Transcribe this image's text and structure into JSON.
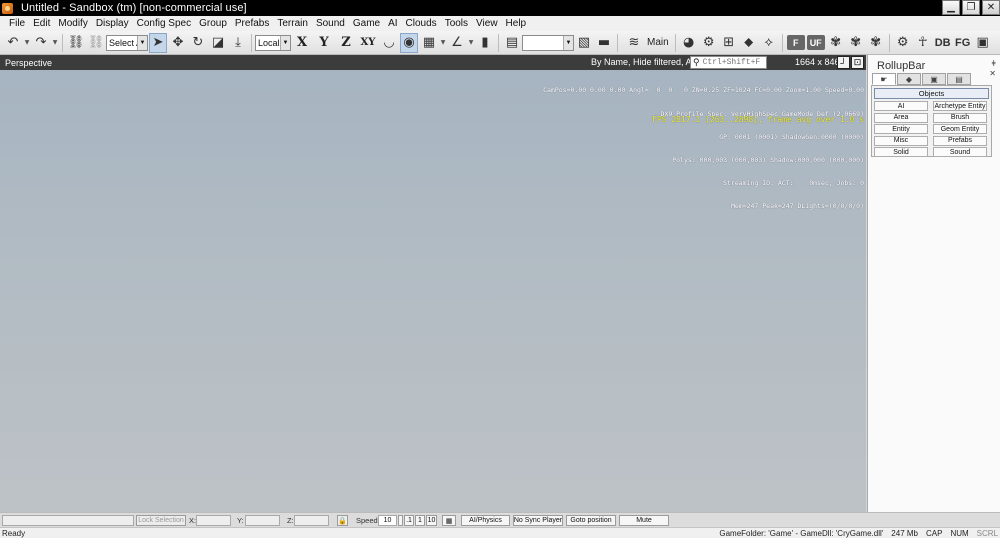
{
  "window": {
    "title": "Untitled - Sandbox (tm) [non-commercial use]",
    "controls": {
      "minimize": "▁",
      "maximize": "❐",
      "close": "✕"
    }
  },
  "menu": [
    "File",
    "Edit",
    "Modify",
    "Display",
    "Config Spec",
    "Group",
    "Prefabs",
    "Terrain",
    "Sound",
    "Game",
    "AI",
    "Clouds",
    "Tools",
    "View",
    "Help"
  ],
  "toolbar": {
    "undo_icon": "↶",
    "redo_icon": "↷",
    "dropdown_glyph": "▼",
    "link_icon": "⛓",
    "unlink_icon": "⛓",
    "selection_filter": "Select All",
    "select_icon": "➤",
    "move_icon": "✥",
    "rotate_icon": "↻",
    "scale_icon": "◪",
    "drop_icon": "⤓",
    "ref_coord": "Local",
    "axis_x": "X",
    "axis_y": "Y",
    "axis_z": "Z",
    "axis_xy": "XY",
    "terrain_snap_icon": "◡",
    "object_snap_icon": "◉",
    "grid_icon": "▦",
    "angle_icon": "∠",
    "ruler_icon": "▮",
    "layer_icon": "▤",
    "layer_combo": "",
    "tool_icon_a": "▧",
    "tool_icon_b": "▬",
    "layers_icon": "≋",
    "main_label": "Main",
    "icons_right": [
      "◕",
      "⚙",
      "⊞",
      "⬥",
      "⟡"
    ],
    "f_label": "F",
    "uf_label": "UF",
    "atom_icons": [
      "✾",
      "✾",
      "✾"
    ],
    "gear2_icon": "⚙",
    "person_icon": "☥",
    "db_label": "DB",
    "fg_label": "FG",
    "end_icon": "▣"
  },
  "viewport": {
    "title": "Perspective",
    "filter_text": "By Name, Hide filtered, AND",
    "search_placeholder": "Ctrl+Shift+F",
    "search_icon": "⚲",
    "resolution": "1664 x 846",
    "pin_icon": "┘",
    "maximize_icon": "⊡",
    "debug_lines": [
      "CamPos=0.00 0.00 0.00 Angl=  0  0   0 ZN=0.25 ZF=1024 FC=0.00 Zoom=1.00 Speed=0.00",
      "DX9 Profile Spec: VeryHighSpec GameMode Def (2.0669)",
      "GP: 0001 (0001) ShadowGen:0000 (0000)",
      "Polys: 000,003 (000,003) Shadow:000,000 (000,000)",
      "Streaming IO: ACT:    0msec, Jobs: 0",
      "Mem=247 Peak=247 DLights=(0/0/0/0)"
    ],
    "fps_text": "FPS 2817.1 [263..2898], frame avg over 1.0 s"
  },
  "rollup": {
    "title": "RollupBar",
    "pin_icon": "ǂ",
    "close_icon": "✕",
    "tabs": [
      "☛",
      "◆",
      "▣",
      "▤"
    ],
    "objects_header": "Objects",
    "object_buttons": [
      "AI",
      "Archetype Entity",
      "Area",
      "Brush",
      "Entity",
      "Geom Entity",
      "Misc",
      "Prefabs",
      "Solid",
      "Sound"
    ]
  },
  "bottom": {
    "lock_selection": "Lock Selection",
    "x_label": "X:",
    "y_label": "Y:",
    "z_label": "Z:",
    "lock_icon": "🔒",
    "speed_label": "Speed:",
    "speed_value": "10",
    "speed_presets": [
      ".1",
      "1",
      "10"
    ],
    "grid_icon": "▦",
    "ai_physics": "AI/Physics",
    "no_sync_player": "No Sync Player",
    "goto_position": "Goto position",
    "mute": "Mute"
  },
  "status": {
    "ready": "Ready",
    "game_folder": "GameFolder: 'Game' - GameDll: 'CryGame.dll'",
    "memory": "247 Mb",
    "cap": "CAP",
    "num": "NUM",
    "scrl": "SCRL"
  }
}
